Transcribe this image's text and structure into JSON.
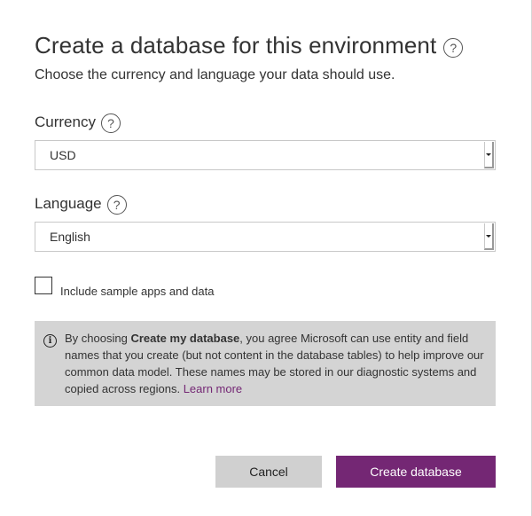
{
  "dialog": {
    "title": "Create a database for this environment",
    "subtitle": "Choose the currency and language your data should use.",
    "help_glyph": "?"
  },
  "currency": {
    "label": "Currency",
    "selected": "USD"
  },
  "language": {
    "label": "Language",
    "selected": "English"
  },
  "sample": {
    "label": "Include sample apps and data",
    "checked": false
  },
  "info": {
    "icon_glyph": "i",
    "text_prefix": "By choosing ",
    "text_bold": "Create my database",
    "text_body": ", you agree Microsoft can use entity and field names that you create (but not content in the database tables) to help improve our common data model. These names may be stored in our diagnostic systems and copied across regions. ",
    "link": "Learn more"
  },
  "buttons": {
    "cancel": "Cancel",
    "create": "Create database"
  },
  "colors": {
    "accent": "#742774",
    "info_bg": "#d4d4d4",
    "cancel_bg": "#d0d0d0"
  }
}
